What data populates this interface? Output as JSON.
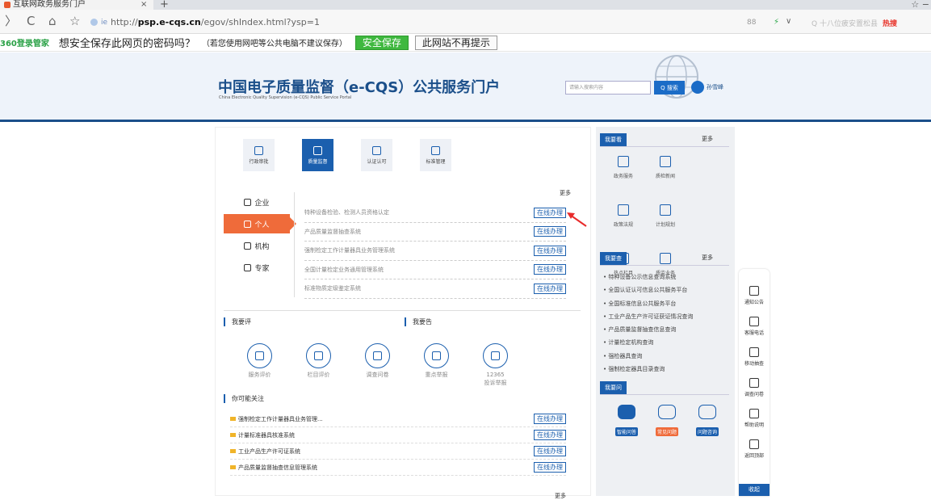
{
  "browser": {
    "tab_title": "互联网政务服务门户",
    "tab_close": "×",
    "tab_new": "+",
    "win_ctrl": "☆ −",
    "nav_back": "〉",
    "nav_reload": "C",
    "nav_home": "⌂",
    "nav_star": "☆",
    "url_ie": "ie",
    "url_proto": "http://",
    "url_host": "psp.e-cqs.cn",
    "url_path": "/egov/shIndex.html?ysp=1",
    "addr_right": "88",
    "addr_arrow": "⚡",
    "addr_chev": "∨",
    "search_placeholder": "Q  十八位疲安置松县",
    "search_hot": "热搜"
  },
  "password_bar": {
    "logo": "360登录管家",
    "question": "想安全保存此网页的密码吗？",
    "note": "（若您使用网吧等公共电脑不建议保存）",
    "save_label": "安全保存",
    "never_label": "此网站不再提示"
  },
  "header": {
    "title": "中国电子质量监督（e-CQS）公共服务门户",
    "subtitle": "China Electronic Quality Supervision (e-CQS) Public Service Portal",
    "search_placeholder": "请输入搜索内容",
    "search_button": "Q 搜索",
    "user_name": "孙雪峰"
  },
  "categories": [
    {
      "label": "行政审批",
      "active": false
    },
    {
      "label": "质量监督",
      "active": true
    },
    {
      "label": "认证认可",
      "active": false
    },
    {
      "label": "标准管理",
      "active": false
    }
  ],
  "side_tabs": [
    {
      "label": "企业",
      "active": false
    },
    {
      "label": "个人",
      "active": true
    },
    {
      "label": "机构",
      "active": false
    },
    {
      "label": "专家",
      "active": false
    }
  ],
  "services_more": "更多",
  "services": [
    {
      "name": "特种设备检验、检测人员资格认定",
      "action": "在线办理"
    },
    {
      "name": "产品质量监督抽查系统",
      "action": "在线办理"
    },
    {
      "name": "强制检定工作计量器具业务管理系统",
      "action": "在线办理"
    },
    {
      "name": "全国计量检定业务通用管理系统",
      "action": "在线办理"
    },
    {
      "name": "标准物质定级鉴定系统",
      "action": "在线办理"
    }
  ],
  "sections": {
    "evaluate": "我要评",
    "report": "我要告",
    "focus": "你可能关注"
  },
  "evaluate_items": [
    {
      "label": "服务评价",
      "icon": "service-eval-icon"
    },
    {
      "label": "栏目评价",
      "icon": "column-eval-icon"
    },
    {
      "label": "调查问卷",
      "icon": "survey-icon"
    },
    {
      "label": "重点举报",
      "icon": "report-icon"
    },
    {
      "label": "12365\n投诉举报",
      "icon": "complaint-icon"
    }
  ],
  "focus_items": [
    {
      "name": "强制检定工作计量器具业务管理...",
      "action": "在线办理"
    },
    {
      "name": "计量标准器具核准系统",
      "action": "在线办理"
    },
    {
      "name": "工业产品生产许可证系统",
      "action": "在线办理"
    },
    {
      "name": "产品质量监督抽查信息管理系统",
      "action": "在线办理"
    }
  ],
  "bottom_more": "更多",
  "right_panel": {
    "see_tag": "我要看",
    "see_more": "更多",
    "see_items": [
      "政务服务",
      "质检新闻",
      "政策法规",
      "计划规划",
      "热点栏目",
      "质监业务"
    ],
    "check_tag": "我要查",
    "check_more": "更多",
    "check_links": [
      "• 特种设备公示信息查询系统",
      "• 全国认证认可信息公共服务平台",
      "• 全国标准信息公共服务平台",
      "• 工业产品生产许可证获证情况查询",
      "• 产品质量监督抽查信息查询",
      "• 计量检定机构查询",
      "• 强检器具查询",
      "• 强制检定器具目录查询"
    ],
    "ask_tag": "我要问",
    "ask_items": [
      {
        "label": "智能问答",
        "color": "#1b5fae"
      },
      {
        "label": "常见问题",
        "color": "#ef6b3a"
      },
      {
        "label": "问题咨询",
        "color": "#1b5fae"
      }
    ]
  },
  "float_bar": [
    {
      "label": "通知公告",
      "icon": "speaker-icon"
    },
    {
      "label": "客服电话",
      "icon": "phone-icon"
    },
    {
      "label": "移动抽查",
      "icon": "mobile-icon"
    },
    {
      "label": "调查问卷",
      "icon": "survey-icon"
    },
    {
      "label": "帮助说明",
      "icon": "help-icon"
    },
    {
      "label": "返回顶部",
      "icon": "top-icon"
    }
  ],
  "collapse_label": "收起",
  "colors": {
    "primary": "#1b5fae",
    "accent": "#ef6b3a",
    "header_bg": "#eef3fa"
  }
}
